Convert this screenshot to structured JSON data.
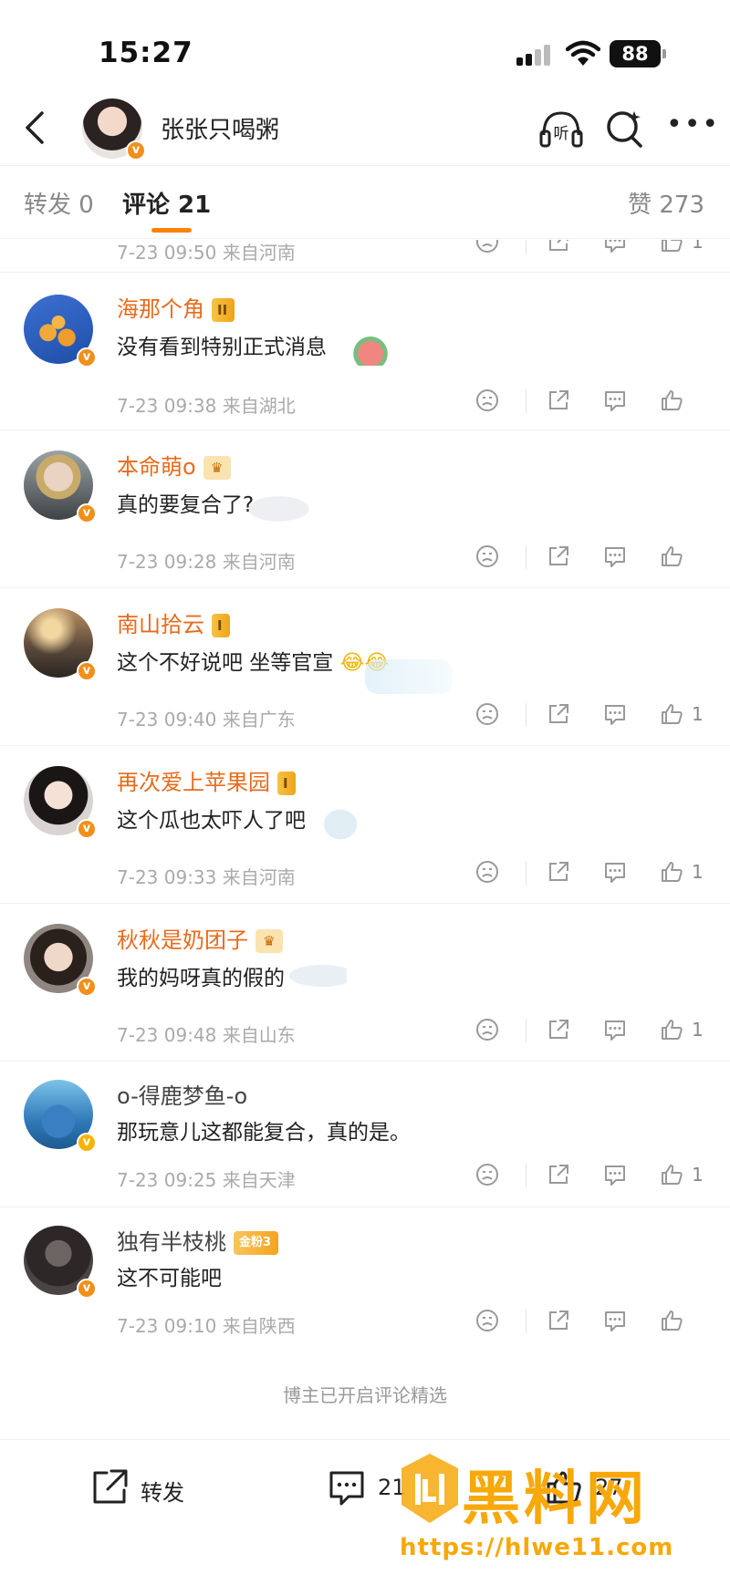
{
  "status_bar": {
    "time": "15:27",
    "battery": "88"
  },
  "header": {
    "account_name": "张张只喝粥",
    "listen_label": "听"
  },
  "tabs": {
    "repost": "转发 0",
    "comments": "评论 21",
    "likes": "赞 273"
  },
  "partial_row": {
    "meta": "7-23 09:50  来自河南",
    "likes": "1"
  },
  "comments": [
    {
      "name": "海那个角",
      "badge": "II",
      "text": "没有看到特别正式消息",
      "meta": "7-23 09:38  来自湖北",
      "likes": ""
    },
    {
      "name": "本命萌o",
      "badge": "",
      "text": "真的要复合了?",
      "meta": "7-23 09:28  来自河南",
      "likes": ""
    },
    {
      "name": "南山拾云",
      "badge": "I",
      "text": "这个不好说吧 坐等官宣",
      "meta": "7-23 09:40  来自广东",
      "likes": "1"
    },
    {
      "name": "再次爱上苹果园",
      "badge": "I",
      "text": "这个瓜也太吓人了吧",
      "meta": "7-23 09:33  来自河南",
      "likes": "1"
    },
    {
      "name": "秋秋是奶团子",
      "badge": "",
      "text": "我的妈呀真的假的",
      "meta": "7-23 09:48  来自山东",
      "likes": "1"
    },
    {
      "name": "o-得鹿梦鱼-o",
      "badge": "",
      "text": "那玩意儿这都能复合，真的是。",
      "meta": "7-23 09:25  来自天津",
      "likes": "1"
    },
    {
      "name": "独有半枝桃",
      "badge": "金粉3",
      "text": "这不可能吧",
      "meta": "7-23 09:10  来自陕西",
      "likes": ""
    }
  ],
  "footer_note": "博主已开启评论精选",
  "bottom_bar": {
    "repost": "转发",
    "comment": "21",
    "like": "27"
  },
  "watermark": {
    "title": "黑料网",
    "url": "https://hlwe11.com"
  },
  "colors": {
    "accent": "#ff8200",
    "name_orange": "#e86b1c",
    "meta_gray": "#aaaaaa"
  }
}
